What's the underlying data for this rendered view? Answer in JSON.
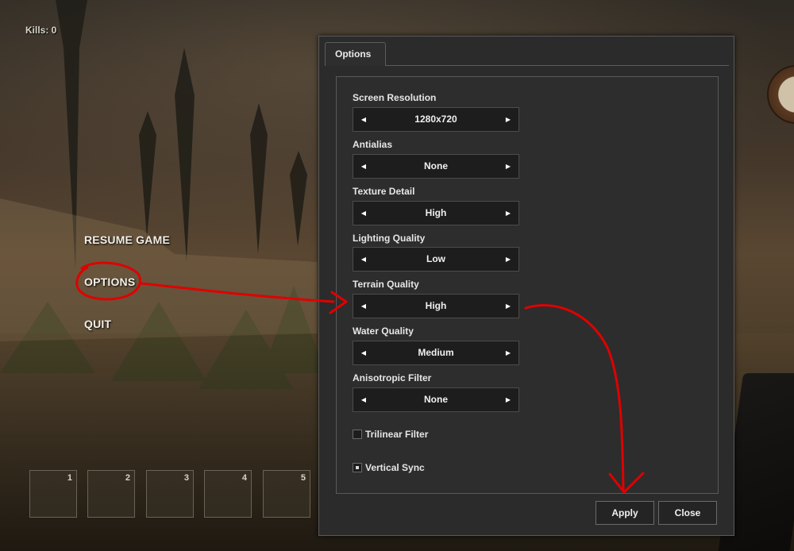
{
  "hud": {
    "kills": "Kills: 0"
  },
  "pause_menu": {
    "items": [
      {
        "label": "RESUME GAME"
      },
      {
        "label": "OPTIONS"
      },
      {
        "label": "QUIT"
      }
    ]
  },
  "hotbar": {
    "slots": [
      "1",
      "2",
      "3",
      "4",
      "5"
    ]
  },
  "options_dialog": {
    "tab": "Options",
    "settings": [
      {
        "label": "Screen Resolution",
        "value": "1280x720"
      },
      {
        "label": "Antialias",
        "value": "None"
      },
      {
        "label": "Texture Detail",
        "value": "High"
      },
      {
        "label": "Lighting Quality",
        "value": "Low"
      },
      {
        "label": "Terrain Quality",
        "value": "High"
      },
      {
        "label": "Water Quality",
        "value": "Medium"
      },
      {
        "label": "Anisotropic Filter",
        "value": "None"
      }
    ],
    "checkboxes": [
      {
        "label": "Trilinear Filter",
        "checked": false
      },
      {
        "label": "Vertical Sync",
        "checked": true
      }
    ],
    "buttons": {
      "apply": "Apply",
      "close": "Close"
    }
  },
  "icons": {
    "left_arrow": "triangle-left-icon",
    "right_arrow": "triangle-right-icon"
  },
  "colors": {
    "annotation": "#e00000",
    "panel_bg": "#2b2b2b",
    "field_bg": "#1d1d1d"
  }
}
